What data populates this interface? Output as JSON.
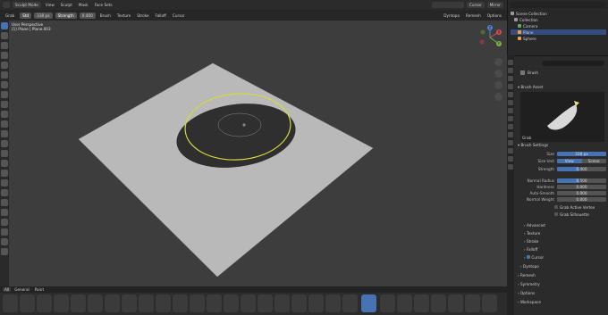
{
  "header": {
    "menus": [
      "Sculpt Mode",
      "View",
      "Sculpt",
      "Mask",
      "Face Sets"
    ],
    "right": [
      "Cursor"
    ],
    "overlay_right": [
      "Mirror"
    ]
  },
  "tool_header": {
    "tool_name": "Grab",
    "radius_mode": "Std",
    "radius_value": "338 px",
    "strength_label": "Strength",
    "strength_value": "0.400",
    "menus": [
      "Brush",
      "Texture",
      "Stroke",
      "Falloff",
      "Cursor"
    ],
    "right_menus": [
      "Dyntopo",
      "Remesh",
      "Options"
    ]
  },
  "viewport": {
    "view_name": "User Perspective",
    "object_name": "(1) Plane | Plane.003",
    "gizmo": {
      "x": "X",
      "y": "Y",
      "z": "Z"
    }
  },
  "bottom_tabs": [
    "All",
    "General",
    "Paint"
  ],
  "outliner": {
    "title": "Scene Collection",
    "items": [
      {
        "label": "Collection",
        "color": "#9a9a9a",
        "selected": false,
        "indent": 1
      },
      {
        "label": "Camera",
        "color": "#64a85a",
        "selected": false,
        "indent": 2
      },
      {
        "label": "Plane",
        "color": "#e6a04b",
        "selected": true,
        "indent": 2
      },
      {
        "label": "Sphere",
        "color": "#e6a04b",
        "selected": false,
        "indent": 2
      }
    ]
  },
  "properties": {
    "search_placeholder": "",
    "brush_label": "Brush",
    "brush_asset": "Brush Asset",
    "brush_preview_name": "Grab",
    "brush_settings": "Brush Settings",
    "size_label": "Size",
    "size_value": "338 px",
    "size_unit_label": "Size Unit",
    "size_unit_options": [
      "View",
      "Scene"
    ],
    "size_unit_selected": "View",
    "strength_label": "Strength",
    "strength_value": "0.400",
    "normal_radius_label": "Normal Radius",
    "normal_radius_value": "0.500",
    "hardness_label": "Hardness",
    "hardness_value": "0.000",
    "auto_smooth_label": "Auto-Smooth",
    "auto_smooth_value": "0.000",
    "normal_weight_label": "Normal Weight",
    "normal_weight_value": "0.000",
    "grab_active_vertex": "Grab Active Vertex",
    "grab_silhouette": "Grab Silhouette",
    "sub_sections": [
      "Advanced",
      "Texture",
      "Stroke",
      "Falloff",
      "Cursor",
      "Dyntopo"
    ],
    "sections": [
      "Remesh",
      "Symmetry",
      "Options",
      "Workspace"
    ]
  },
  "colors": {
    "accent": "#4772b3",
    "brush_circle": "#d6d83a",
    "plane": "#b9b9b9"
  }
}
